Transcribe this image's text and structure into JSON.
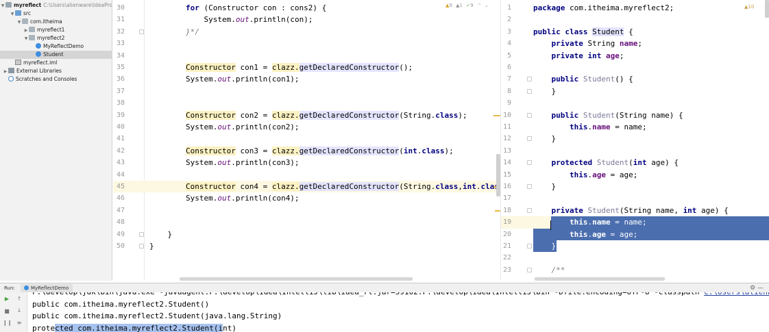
{
  "project_tree": {
    "root": {
      "name": "myreflect",
      "path": "C:\\Users\\alienware\\IdeaProj"
    },
    "items": [
      {
        "label": "src",
        "icon": "source-folder-icon",
        "depth": 1,
        "arrow": "down"
      },
      {
        "label": "com.itheima",
        "icon": "package-icon",
        "depth": 2,
        "arrow": "down"
      },
      {
        "label": "myreflect1",
        "icon": "package-icon",
        "depth": 3,
        "arrow": "right"
      },
      {
        "label": "myreflect2",
        "icon": "package-icon",
        "depth": 3,
        "arrow": "down"
      },
      {
        "label": "MyReflectDemo",
        "icon": "class-icon",
        "depth": 4,
        "arrow": ""
      },
      {
        "label": "Student",
        "icon": "class-icon",
        "depth": 4,
        "arrow": "",
        "selected": true
      },
      {
        "label": "myreflect.iml",
        "icon": "module-file-icon",
        "depth": 1,
        "arrow": ""
      },
      {
        "label": "External Libraries",
        "icon": "library-icon",
        "depth": 0,
        "arrow": "right"
      },
      {
        "label": "Scratches and Consoles",
        "icon": "scratches-icon",
        "depth": 0,
        "arrow": ""
      }
    ]
  },
  "left_editor": {
    "inspections": {
      "warnings": "9",
      "weak": "1",
      "typos": "9"
    },
    "current_line": 45,
    "lines": [
      {
        "n": "30",
        "segs": [
          {
            "t": "        "
          },
          {
            "t": "for",
            "c": "kw"
          },
          {
            "t": " (Constructor con : cons2) {"
          }
        ]
      },
      {
        "n": "31",
        "segs": [
          {
            "t": "            System."
          },
          {
            "t": "out",
            "c": "t-field"
          },
          {
            "t": ".println(con);"
          }
        ]
      },
      {
        "n": "32",
        "segs": [
          {
            "t": "        }*/",
            "c": "t-cmt"
          }
        ]
      },
      {
        "n": "33",
        "segs": []
      },
      {
        "n": "34",
        "segs": []
      },
      {
        "n": "35",
        "segs": [
          {
            "t": "        "
          },
          {
            "t": "Constructor",
            "c": "t-type"
          },
          {
            "t": " con1 = "
          },
          {
            "t": "clazz.",
            "c": "t-mcall"
          },
          {
            "t": "getDeclaredConstructor",
            "c": "t-cls-hl"
          },
          {
            "t": "();"
          }
        ]
      },
      {
        "n": "36",
        "segs": [
          {
            "t": "        System."
          },
          {
            "t": "out",
            "c": "t-field"
          },
          {
            "t": ".println(con1);"
          }
        ]
      },
      {
        "n": "37",
        "segs": []
      },
      {
        "n": "38",
        "segs": []
      },
      {
        "n": "39",
        "segs": [
          {
            "t": "        "
          },
          {
            "t": "Constructor",
            "c": "t-type"
          },
          {
            "t": " con2 = "
          },
          {
            "t": "clazz.",
            "c": "t-mcall"
          },
          {
            "t": "getDeclaredConstructor",
            "c": "t-cls-hl"
          },
          {
            "t": "(String."
          },
          {
            "t": "class",
            "c": "kw"
          },
          {
            "t": ");"
          }
        ]
      },
      {
        "n": "40",
        "segs": [
          {
            "t": "        System."
          },
          {
            "t": "out",
            "c": "t-field"
          },
          {
            "t": ".println(con2);"
          }
        ]
      },
      {
        "n": "41",
        "segs": []
      },
      {
        "n": "42",
        "segs": [
          {
            "t": "        "
          },
          {
            "t": "Constructor",
            "c": "t-type"
          },
          {
            "t": " con3 = "
          },
          {
            "t": "clazz.",
            "c": "t-mcall"
          },
          {
            "t": "getDeclaredConstructor",
            "c": "t-cls-hl"
          },
          {
            "t": "("
          },
          {
            "t": "int",
            "c": "kw"
          },
          {
            "t": "."
          },
          {
            "t": "class",
            "c": "kw"
          },
          {
            "t": ");"
          }
        ]
      },
      {
        "n": "43",
        "segs": [
          {
            "t": "        System."
          },
          {
            "t": "out",
            "c": "t-field"
          },
          {
            "t": ".println(con3);"
          }
        ]
      },
      {
        "n": "44",
        "segs": []
      },
      {
        "n": "45",
        "segs": [
          {
            "t": "        "
          },
          {
            "t": "Constructor",
            "c": "t-type"
          },
          {
            "t": " con4 = "
          },
          {
            "t": "clazz.",
            "c": "t-mcall"
          },
          {
            "t": "getDeclaredConstructor",
            "c": "t-cls-hl"
          },
          {
            "t": "(String."
          },
          {
            "t": "class",
            "c": "kw"
          },
          {
            "t": ","
          },
          {
            "t": "int",
            "c": "kw"
          },
          {
            "t": "."
          },
          {
            "t": "class",
            "c": "kw"
          }
        ]
      },
      {
        "n": "46",
        "segs": [
          {
            "t": "        System."
          },
          {
            "t": "out",
            "c": "t-field"
          },
          {
            "t": ".println(con4);"
          }
        ]
      },
      {
        "n": "47",
        "segs": []
      },
      {
        "n": "48",
        "segs": []
      },
      {
        "n": "49",
        "segs": [
          {
            "t": "    }"
          }
        ]
      },
      {
        "n": "50",
        "segs": [
          {
            "t": "}"
          }
        ]
      }
    ]
  },
  "right_editor": {
    "inspections": {
      "warnings": "10"
    },
    "selection_start": 19,
    "selection_end": 21,
    "lines": [
      {
        "n": "1",
        "segs": [
          {
            "t": "package",
            "c": "kw"
          },
          {
            "t": " com.itheima.myreflect2;"
          }
        ]
      },
      {
        "n": "2",
        "segs": []
      },
      {
        "n": "3",
        "segs": [
          {
            "t": "public",
            "c": "kw"
          },
          {
            "t": " "
          },
          {
            "t": "class",
            "c": "kw"
          },
          {
            "t": " "
          },
          {
            "t": "Student",
            "c": "t-cls-hl"
          },
          {
            "t": " {"
          }
        ]
      },
      {
        "n": "4",
        "segs": [
          {
            "t": "    "
          },
          {
            "t": "private",
            "c": "kw"
          },
          {
            "t": " String "
          },
          {
            "t": "name",
            "c": "t-field-plain"
          },
          {
            "t": ";"
          }
        ]
      },
      {
        "n": "5",
        "segs": [
          {
            "t": "    "
          },
          {
            "t": "private",
            "c": "kw"
          },
          {
            "t": " "
          },
          {
            "t": "int",
            "c": "kw"
          },
          {
            "t": " "
          },
          {
            "t": "age",
            "c": "t-field-plain"
          },
          {
            "t": ";"
          }
        ]
      },
      {
        "n": "6",
        "segs": []
      },
      {
        "n": "7",
        "segs": [
          {
            "t": "    "
          },
          {
            "t": "public",
            "c": "kw"
          },
          {
            "t": " "
          },
          {
            "t": "Student",
            "c": "t-ctor"
          },
          {
            "t": "() {"
          }
        ]
      },
      {
        "n": "8",
        "segs": [
          {
            "t": "    }"
          }
        ]
      },
      {
        "n": "9",
        "segs": []
      },
      {
        "n": "10",
        "segs": [
          {
            "t": "    "
          },
          {
            "t": "public",
            "c": "kw"
          },
          {
            "t": " "
          },
          {
            "t": "Student",
            "c": "t-ctor"
          },
          {
            "t": "(String name) {"
          }
        ]
      },
      {
        "n": "11",
        "segs": [
          {
            "t": "        "
          },
          {
            "t": "this",
            "c": "kw"
          },
          {
            "t": "."
          },
          {
            "t": "name",
            "c": "t-field-plain"
          },
          {
            "t": " = name;"
          }
        ]
      },
      {
        "n": "12",
        "segs": [
          {
            "t": "    }"
          }
        ]
      },
      {
        "n": "13",
        "segs": []
      },
      {
        "n": "14",
        "segs": [
          {
            "t": "    "
          },
          {
            "t": "protected",
            "c": "kw"
          },
          {
            "t": " "
          },
          {
            "t": "Student",
            "c": "t-ctor"
          },
          {
            "t": "("
          },
          {
            "t": "int",
            "c": "kw"
          },
          {
            "t": " age) {"
          }
        ]
      },
      {
        "n": "15",
        "segs": [
          {
            "t": "        "
          },
          {
            "t": "this",
            "c": "kw"
          },
          {
            "t": "."
          },
          {
            "t": "age",
            "c": "t-field-plain"
          },
          {
            "t": " = age;"
          }
        ]
      },
      {
        "n": "16",
        "segs": [
          {
            "t": "    }"
          }
        ]
      },
      {
        "n": "17",
        "segs": []
      },
      {
        "n": "18",
        "segs": [
          {
            "t": "    "
          },
          {
            "t": "private",
            "c": "kw"
          },
          {
            "t": " "
          },
          {
            "t": "Student",
            "c": "t-ctor"
          },
          {
            "t": "(String name, "
          },
          {
            "t": "int",
            "c": "kw"
          },
          {
            "t": " age) {"
          }
        ]
      },
      {
        "n": "19",
        "segs": [
          {
            "t": "        "
          },
          {
            "t": "this",
            "c": "kw"
          },
          {
            "t": "."
          },
          {
            "t": "name",
            "c": "t-field-plain"
          },
          {
            "t": " = name;"
          }
        ]
      },
      {
        "n": "20",
        "segs": [
          {
            "t": "        "
          },
          {
            "t": "this",
            "c": "kw"
          },
          {
            "t": "."
          },
          {
            "t": "age",
            "c": "t-field-plain"
          },
          {
            "t": " = age;"
          }
        ]
      },
      {
        "n": "21",
        "segs": [
          {
            "t": "    }"
          }
        ]
      },
      {
        "n": "22",
        "segs": []
      },
      {
        "n": "23",
        "segs": [
          {
            "t": "    "
          },
          {
            "t": "/**",
            "c": "t-cmt"
          }
        ]
      }
    ]
  },
  "run_panel": {
    "label": "Run:",
    "tab": "MyReflectDemo",
    "console": [
      {
        "segs": [
          {
            "t": "F:\\develop\\jdk\\bin\\java.exe -javaagent:F:\\develop\\idea\\IntelliJ\\lib\\idea_rt.jar=59102:F:\\develop\\idea\\IntelliJ\\bin -Dfile.encoding=UTF-8 -classpath "
          },
          {
            "t": "C:\\Users\\alienw",
            "c": "con-link"
          }
        ]
      },
      {
        "segs": [
          {
            "t": "public com.itheima.myreflect2.Student()"
          }
        ]
      },
      {
        "segs": [
          {
            "t": "public com.itheima.myreflect2.Student(java.lang.String)"
          }
        ]
      },
      {
        "segs": [
          {
            "t": "prote"
          },
          {
            "t": "cted com.itheima.myreflect2.Student(i",
            "c": "con-sel"
          },
          {
            "t": "nt)"
          }
        ]
      }
    ]
  }
}
